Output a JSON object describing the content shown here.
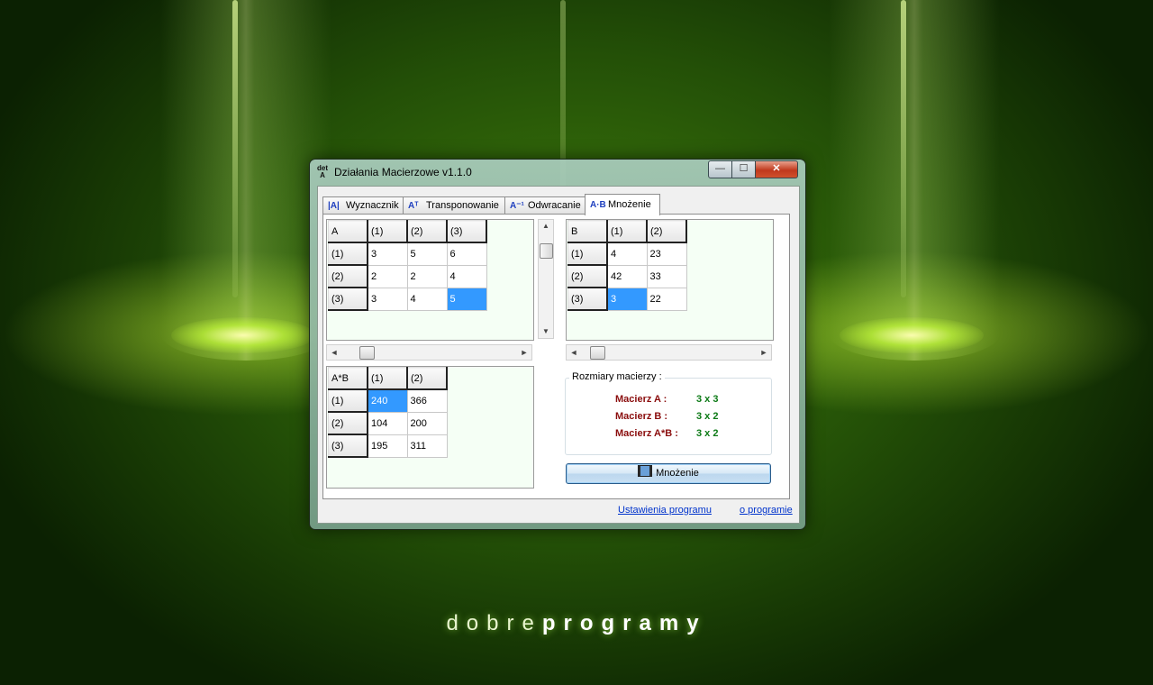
{
  "window": {
    "title": "Działania Macierzowe v1.1.0",
    "app_icon_top": "det",
    "app_icon_bottom": "A"
  },
  "tabs": [
    {
      "icon_text": "|A|",
      "label": "Wyznacznik",
      "active": false
    },
    {
      "icon_text": "Aᵀ",
      "label": "Transponowanie",
      "active": false
    },
    {
      "icon_text": "A⁻¹",
      "label": "Odwracanie",
      "active": false
    },
    {
      "icon_text": "A·B",
      "label": "Mnożenie",
      "active": true
    }
  ],
  "matrix_a": {
    "corner": "A",
    "col_headers": [
      "(1)",
      "(2)",
      "(3)"
    ],
    "rows": [
      {
        "header": "(1)",
        "cells": [
          "3",
          "5",
          "6"
        ]
      },
      {
        "header": "(2)",
        "cells": [
          "2",
          "2",
          "4"
        ]
      },
      {
        "header": "(3)",
        "cells": [
          "3",
          "4",
          "5"
        ]
      }
    ],
    "selected": [
      2,
      2
    ]
  },
  "matrix_b": {
    "corner": "B",
    "col_headers": [
      "(1)",
      "(2)"
    ],
    "rows": [
      {
        "header": "(1)",
        "cells": [
          "4",
          "23"
        ]
      },
      {
        "header": "(2)",
        "cells": [
          "42",
          "33"
        ]
      },
      {
        "header": "(3)",
        "cells": [
          "3",
          "22"
        ]
      }
    ],
    "selected": [
      2,
      0
    ]
  },
  "matrix_result": {
    "corner": "A*B",
    "col_headers": [
      "(1)",
      "(2)"
    ],
    "rows": [
      {
        "header": "(1)",
        "cells": [
          "240",
          "366"
        ]
      },
      {
        "header": "(2)",
        "cells": [
          "104",
          "200"
        ]
      },
      {
        "header": "(3)",
        "cells": [
          "195",
          "311"
        ]
      }
    ],
    "selected": [
      0,
      0
    ]
  },
  "dimensions": {
    "title": "Rozmiary macierzy :",
    "rows": [
      {
        "label": "Macierz A :",
        "value": "3 x 3"
      },
      {
        "label": "Macierz B :",
        "value": "3 x 2"
      },
      {
        "label": "Macierz A*B :",
        "value": "3 x 2"
      }
    ]
  },
  "multiply_button": {
    "label": "Mnożenie",
    "icon": "calculator-icon"
  },
  "links": {
    "settings": "Ustawienia programu",
    "about": "o programie"
  },
  "scroll_arrows": {
    "left": "◄",
    "right": "►",
    "up": "▲",
    "down": "▼"
  },
  "window_controls": {
    "minimize": "—",
    "maximize": "☐",
    "close": "✕"
  },
  "brand": {
    "light": "dobre",
    "bold": "programy"
  },
  "colors": {
    "selection": "#3399ff",
    "dim_label": "#8b0e0e",
    "dim_value": "#0c7a16",
    "link": "#0033cc",
    "grid_background": "#f5fff5"
  }
}
